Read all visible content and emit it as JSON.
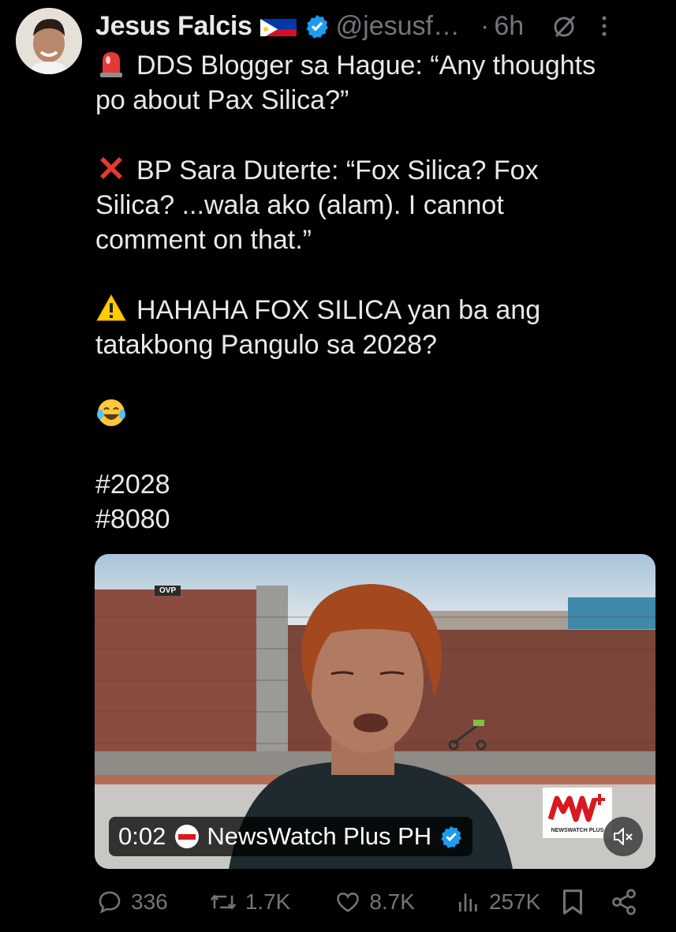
{
  "author": {
    "name": "Jesus Falcis",
    "handle": "@jesusf…",
    "separator": "·",
    "time": "6h"
  },
  "tweet": {
    "lines": [
      "DDS Blogger sa Hague: “Any thoughts",
      "po about Pax Silica?”",
      "BP Sara Duterte: “Fox Silica? Fox",
      "Silica? ...wala ako (alam). I cannot",
      "comment on that.”",
      "HAHAHA FOX SILICA yan ba ang",
      "tatakbong Pangulo sa 2028?",
      "#2028",
      "#8080"
    ],
    "icons": [
      "siren-emoji",
      "cross-mark-emoji",
      "warning-emoji",
      "laughing-tears-emoji"
    ]
  },
  "media": {
    "badge": "OVP",
    "duration": "0:02",
    "source": "NewsWatch Plus PH",
    "logo_text": "NEWSWATCH PLUS"
  },
  "actions": {
    "replies": "336",
    "reposts": "1.7K",
    "likes": "8.7K",
    "views": "257K"
  },
  "colors": {
    "background": "#000000",
    "text": "#e7e9ea",
    "muted": "#71767b",
    "verified": "#1d9bf0"
  }
}
